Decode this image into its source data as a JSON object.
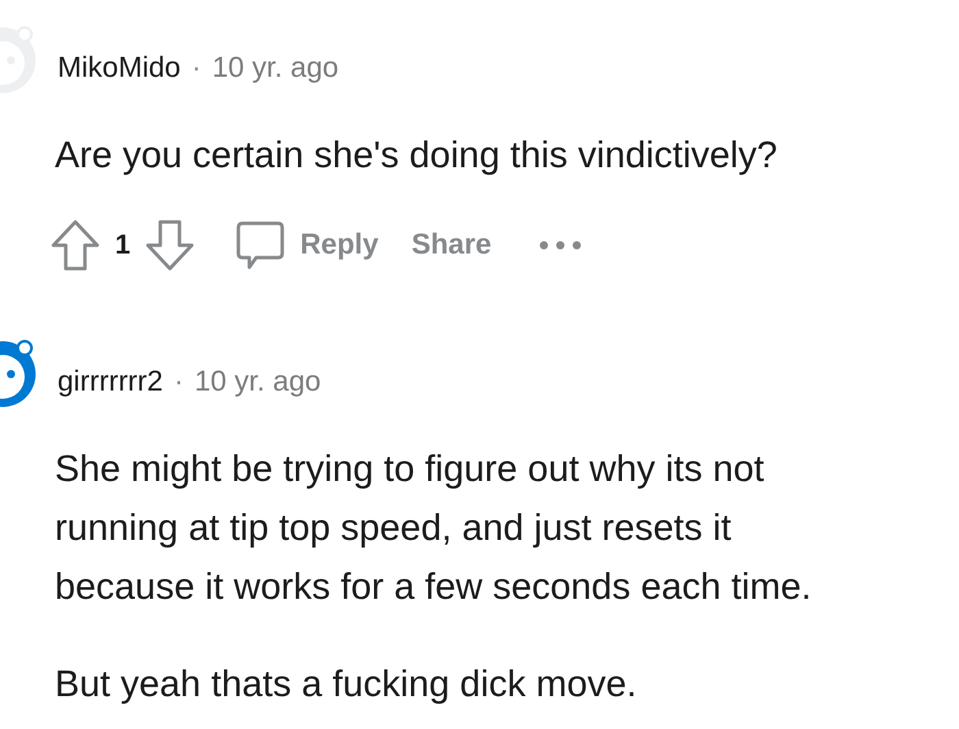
{
  "comments": [
    {
      "author": "MikoMido",
      "separator": "·",
      "time": "10 yr. ago",
      "avatar": {
        "color": "#edeff1"
      },
      "paragraphs": [
        "Are you certain she's doing this vindictively?"
      ],
      "actions": {
        "score": "1",
        "reply": "Reply",
        "share": "Share"
      }
    },
    {
      "author": "girrrrrrr2",
      "separator": "·",
      "time": "10 yr. ago",
      "avatar": {
        "color": "#0079d3"
      },
      "paragraphs": [
        "She might be trying to figure out why its not running at tip top speed, and just resets it because it works for a few seconds each time.",
        "But yeah thats a fucking dick move."
      ]
    }
  ]
}
